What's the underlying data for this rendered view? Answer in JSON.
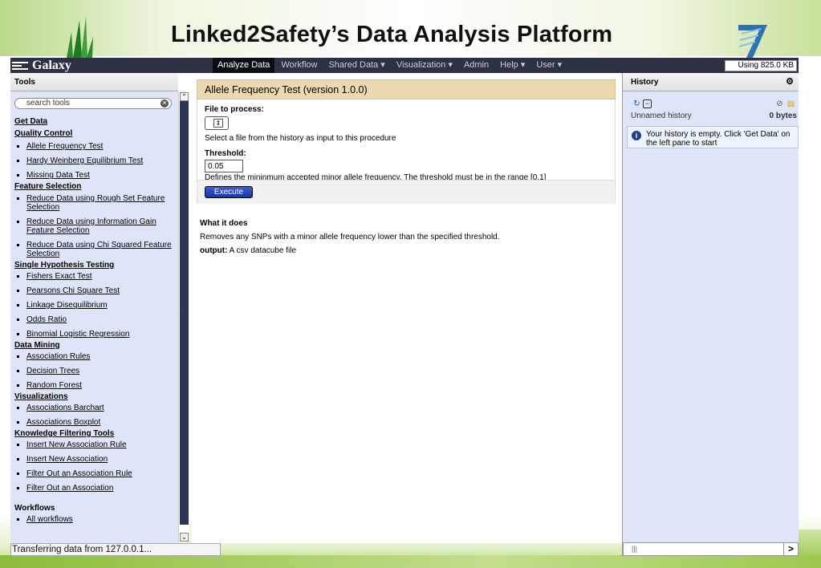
{
  "slide": {
    "title": "Linked2Safety’s Data Analysis Platform"
  },
  "masthead": {
    "brand": "Galaxy",
    "nav": [
      {
        "label": "Analyze Data",
        "active": true
      },
      {
        "label": "Workflow"
      },
      {
        "label": "Shared Data ▾"
      },
      {
        "label": "Visualization ▾"
      },
      {
        "label": "Admin"
      },
      {
        "label": "Help ▾"
      },
      {
        "label": "User ▾"
      }
    ],
    "quota": "Using 825.0 KB"
  },
  "tools": {
    "header": "Tools",
    "search_placeholder": "search tools",
    "sections": [
      {
        "title": "Get Data",
        "items": []
      },
      {
        "title": "Quality Control",
        "items": [
          "Allele Frequency Test",
          "Hardy Weinberg Equilibrium Test",
          "Missing Data Test"
        ]
      },
      {
        "title": "Feature Selection",
        "items": [
          "Reduce Data using Rough Set Feature Selection",
          "Reduce Data using Information Gain Feature Selection",
          "Reduce Data using Chi Squared Feature Selection"
        ]
      },
      {
        "title": "Single Hypothesis Testing",
        "items": [
          "Fishers Exact Test",
          "Pearsons Chi Square Test",
          "Linkage Disequilibrium",
          "Odds Ratio",
          "Binomial Logistic Regression"
        ]
      },
      {
        "title": "Data Mining",
        "items": [
          "Association Rules",
          "Decision Trees",
          "Random Forest"
        ]
      },
      {
        "title": "Visualizations",
        "items": [
          "Associations Barchart",
          "Associations Boxplot"
        ]
      },
      {
        "title": "Knowledge Filtering Tools",
        "items": [
          "Insert New Association Rule",
          "Insert New Association",
          "Filter Out an Association Rule",
          "Filter Out an Association"
        ]
      },
      {
        "title": "Workflows",
        "items": [
          "All workflows"
        ]
      }
    ]
  },
  "form": {
    "title": "Allele Frequency Test (version 1.0.0)",
    "file_label": "File to process:",
    "file_help": "Select a file from the history as input to this procedure",
    "threshold_label": "Threshold:",
    "threshold_value": "0.05",
    "threshold_help": "Defines the mininmum accepted minor allele frequency. The threshold must be in the range [0,1]",
    "execute": "Execute"
  },
  "help": {
    "title": "What it does",
    "text": "Removes any SNPs with a minor allele frequency lower than the specified threshold.",
    "output_label": "output:",
    "output_text": " A csv datacube file"
  },
  "history": {
    "header": "History",
    "name": "Unnamed history",
    "size": "0 bytes",
    "message": "Your history is empty. Click 'Get Data' on the left pane to start"
  },
  "status": "Transferring data from 127.0.0.1..."
}
